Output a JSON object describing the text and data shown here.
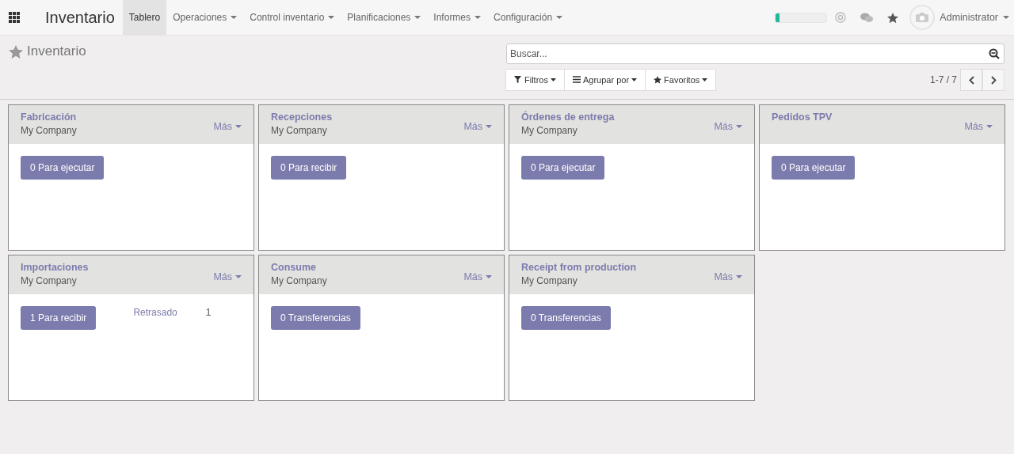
{
  "navbar": {
    "app_title": "Inventario",
    "menu": [
      {
        "label": "Tablero",
        "selected": true,
        "dropdown": false
      },
      {
        "label": "Operaciones",
        "selected": false,
        "dropdown": true
      },
      {
        "label": "Control inventario",
        "selected": false,
        "dropdown": true
      },
      {
        "label": "Planificaciones",
        "selected": false,
        "dropdown": true
      },
      {
        "label": "Informes",
        "selected": false,
        "dropdown": true
      },
      {
        "label": "Configuración",
        "selected": false,
        "dropdown": true
      }
    ],
    "progress": {
      "level": 0.07
    },
    "user": "Administrator"
  },
  "control_panel": {
    "breadcrumb": "Inventario",
    "search": {
      "placeholder": "Buscar..."
    },
    "filters": [
      {
        "label": "Filtros",
        "kind": "filter"
      },
      {
        "label": "Agrupar por",
        "kind": "group"
      },
      {
        "label": "Favoritos",
        "kind": "favorite"
      }
    ],
    "pager": "1-7 / 7"
  },
  "cards": [
    {
      "title": "Fabricación",
      "company": "My Company",
      "more": "Más",
      "action": "0 Para ejecutar"
    },
    {
      "title": "Recepciones",
      "company": "My Company",
      "more": "Más",
      "action": "0 Para recibir"
    },
    {
      "title": "Órdenes de entrega",
      "company": "My Company",
      "more": "Más",
      "action": "0 Para ejecutar"
    },
    {
      "title": "Pedidos TPV",
      "more": "Más",
      "action": "0 Para ejecutar"
    },
    {
      "title": "Importaciones",
      "company": "My Company",
      "more": "Más",
      "action": "1 Para recibir",
      "stat": {
        "label": "Retrasado",
        "value": "1"
      }
    },
    {
      "title": "Consume",
      "company": "My Company",
      "more": "Más",
      "action": "0 Transferencias"
    },
    {
      "title": "Receipt from production",
      "company": "My Company",
      "more": "Más",
      "action": "0 Transferencias"
    }
  ]
}
